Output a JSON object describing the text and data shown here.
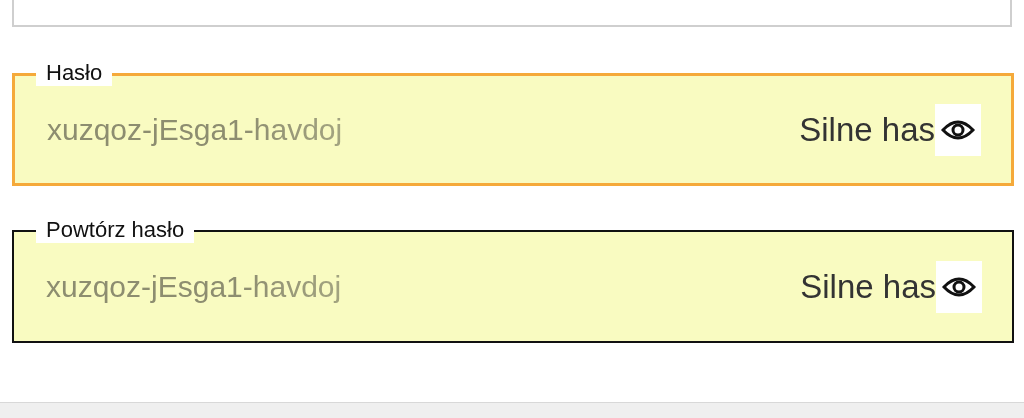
{
  "fields": [
    {
      "label": "Hasło",
      "value": "xuzqoz-jEsga1-havdoj",
      "strength": "Silne has",
      "focused": true
    },
    {
      "label": "Powtórz hasło",
      "value": "xuzqoz-jEsga1-havdoj",
      "strength": "Silne has",
      "focused": false
    }
  ]
}
